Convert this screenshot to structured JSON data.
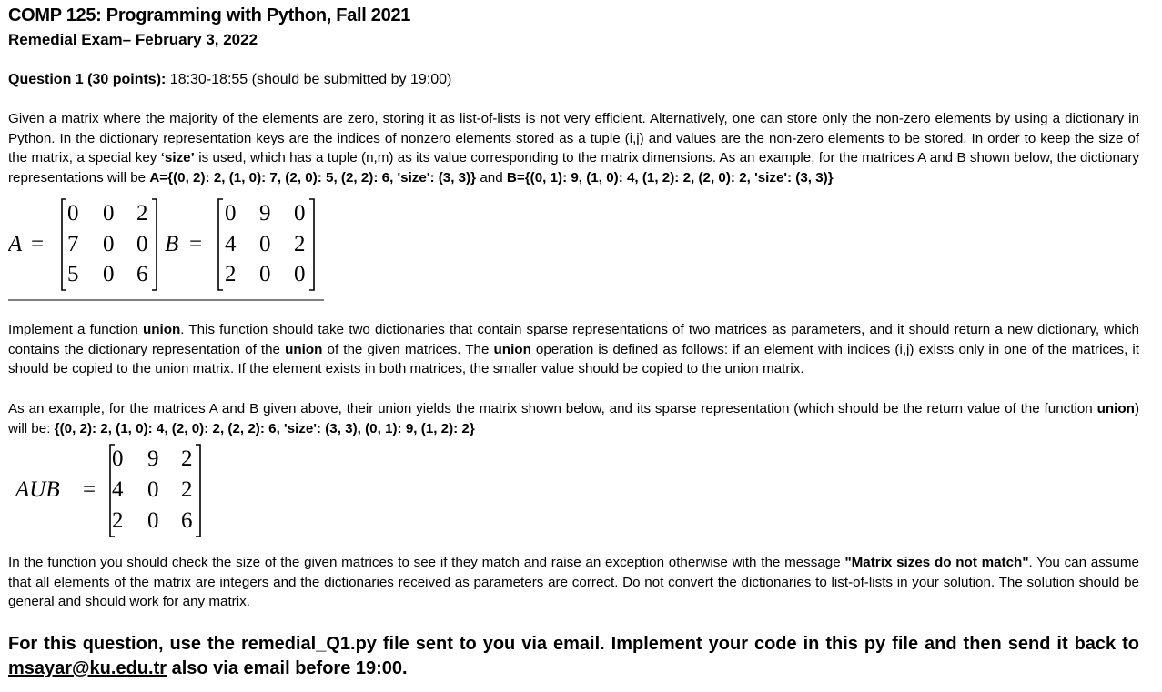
{
  "header": {
    "title": "COMP 125: Programming with Python, Fall 2021",
    "subtitle": "Remedial Exam– February 3, 2022"
  },
  "question": {
    "heading": "Question 1 (30 points)",
    "colon": ":",
    "timing": " 18:30-18:55 (should be submitted by 19:00)"
  },
  "para1": {
    "text": "Given a matrix where the majority of the elements are zero, storing it as list-of-lists is not very efficient. Alternatively, one can store only the non-zero elements by using a dictionary in Python. In the dictionary representation keys are the indices of nonzero elements stored as a tuple (i,j) and values are the non-zero elements to be stored. In order to keep the size of the matrix, a special key ",
    "size_key": "‘size’",
    "text2": " is used, which has a tuple (n,m) as its value corresponding to the matrix dimensions. As an example, for the matrices A and B  shown below, the dictionary representations will be ",
    "dictA": "A={(0, 2): 2, (1, 0): 7, (2, 0): 5, (2, 2): 6, 'size': (3, 3)}",
    "and": " and ",
    "dictB": "B={(0, 1): 9, (1, 0): 4, (1, 2): 2, (2, 0): 2, 'size': (3, 3)}"
  },
  "matrices": {
    "A_label": "A",
    "B_label": "B",
    "equals": "=",
    "A": [
      [
        "0",
        "0",
        "2"
      ],
      [
        "7",
        "0",
        "0"
      ],
      [
        "5",
        "0",
        "6"
      ]
    ],
    "B": [
      [
        "0",
        "9",
        "0"
      ],
      [
        "4",
        "0",
        "2"
      ],
      [
        "2",
        "0",
        "0"
      ]
    ],
    "AUB_label": "AUB",
    "AUB": [
      [
        "0",
        "9",
        "2"
      ],
      [
        "4",
        "0",
        "2"
      ],
      [
        "2",
        "0",
        "6"
      ]
    ]
  },
  "para2": {
    "t1": "Implement a function ",
    "union1": "union",
    "t2": ". This function should take two dictionaries that contain sparse representations of two matrices as parameters, and it should return a new dictionary, which contains the dictionary representation of the ",
    "union2": "union",
    "t3": " of the given matrices. The ",
    "union3": "union",
    "t4": " operation is defined as follows: if an element with indices (i,j) exists only in one of the matrices, it should be copied to the union matrix. If the element exists in both matrices, the smaller value should be copied to the union matrix."
  },
  "para3": {
    "t1": "As an example, for the matrices A and B given above, their union yields the matrix shown below, and its sparse representation (which should be the return value of the function ",
    "union": "union",
    "t2": ") will be: ",
    "result": "{(0, 2): 2, (1, 0): 4, (2, 0): 2, (2, 2): 6, 'size': (3, 3), (0, 1): 9, (1, 2): 2}"
  },
  "para4": {
    "t1": "In the function you should check the size of the given matrices to see if they match and raise an exception otherwise with the message ",
    "message": "\"Matrix sizes do not match\"",
    "t2": ". You can assume that all elements of the matrix are integers and the dictionaries received as parameters are correct. Do not convert the dictionaries to list-of-lists in your solution. The solution should be general and should work for any matrix."
  },
  "final": {
    "t1": "For this question, use the remedial_Q1.py file sent to you via email. Implement your code in this py file and then send it back to ",
    "email": "msayar@ku.edu.tr",
    "t2": " also via email before 19:00."
  }
}
